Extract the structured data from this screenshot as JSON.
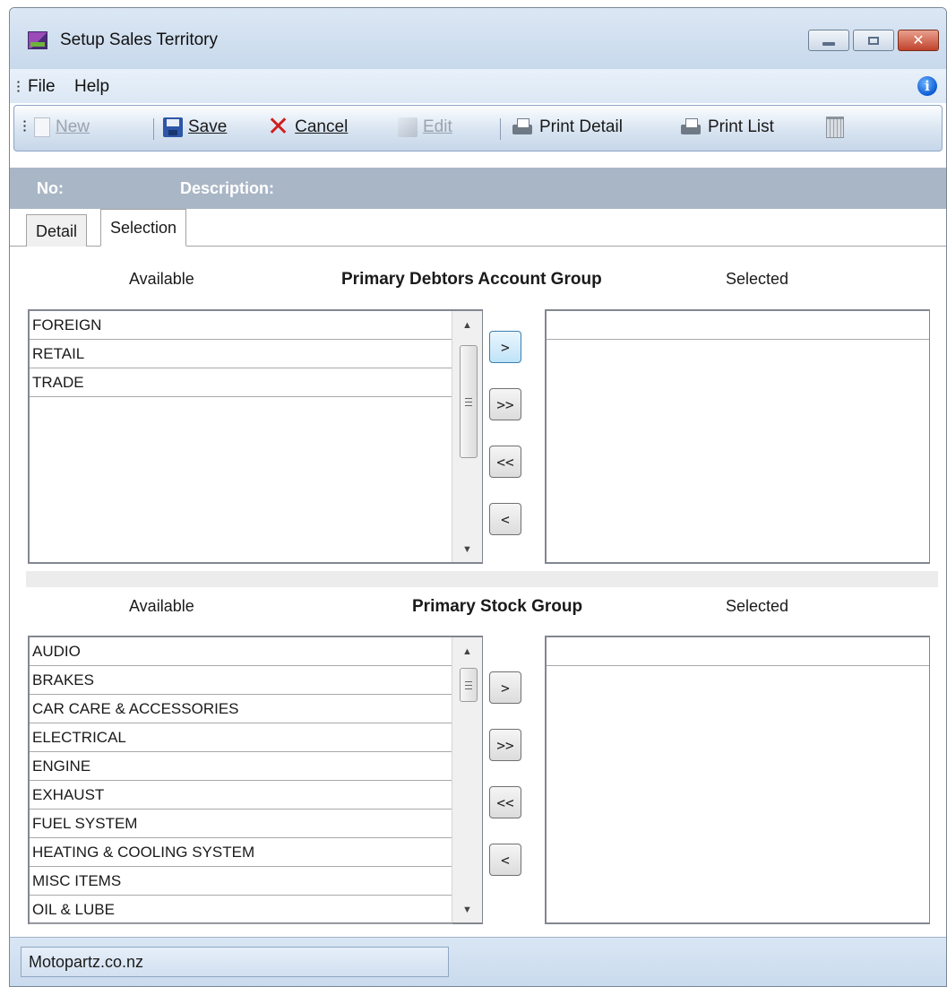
{
  "window": {
    "title": "Setup Sales Territory"
  },
  "menu": {
    "file": "File",
    "help": "Help"
  },
  "toolbar": {
    "new_label": "New",
    "save_label": "Save",
    "cancel_label": "Cancel",
    "edit_label": "Edit",
    "print_detail_label": "Print Detail",
    "print_list_label": "Print List"
  },
  "header": {
    "no_label": "No:",
    "description_label": "Description:"
  },
  "tabs": [
    {
      "label": "Detail"
    },
    {
      "label": "Selection"
    }
  ],
  "debtors": {
    "title": "Primary Debtors Account Group",
    "available_label": "Available",
    "selected_label": "Selected",
    "available_items": [
      "FOREIGN",
      "RETAIL",
      "TRADE"
    ],
    "selected_items": [],
    "buttons": {
      "add": ">",
      "add_all": ">>",
      "remove_all": "<<",
      "remove": "<"
    }
  },
  "stock": {
    "title": "Primary Stock Group",
    "available_label": "Available",
    "selected_label": "Selected",
    "available_items": [
      "AUDIO",
      "BRAKES",
      "CAR CARE & ACCESSORIES",
      "ELECTRICAL",
      "ENGINE",
      "EXHAUST",
      "FUEL SYSTEM",
      "HEATING & COOLING SYSTEM",
      "MISC ITEMS",
      "OIL & LUBE"
    ],
    "selected_items": [],
    "buttons": {
      "add": ">",
      "add_all": ">>",
      "remove_all": "<<",
      "remove": "<"
    }
  },
  "status": {
    "text": "Motopartz.co.nz"
  }
}
